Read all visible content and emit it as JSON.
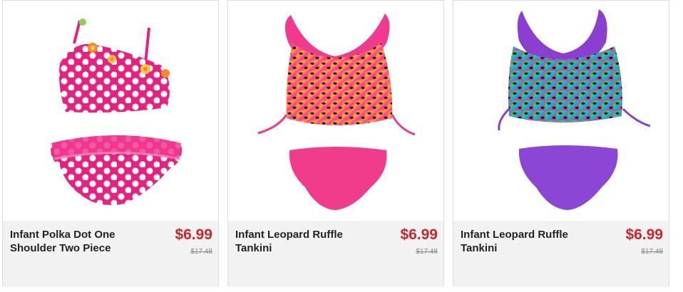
{
  "products": [
    {
      "title": "Infant Polka Dot One Shoulder Two Piece",
      "price": "$6.99",
      "original_price": "$17.48",
      "image_icon": "pink-polka-dot-bikini-image"
    },
    {
      "title": "Infant Leopard Ruffle Tankini",
      "price": "$6.99",
      "original_price": "$17.48",
      "image_icon": "pink-leopard-tankini-image"
    },
    {
      "title": "Infant Leopard Ruffle Tankini",
      "price": "$6.99",
      "original_price": "$17.48",
      "image_icon": "purple-leopard-tankini-image"
    }
  ],
  "colors": {
    "price": "#c8262b",
    "info_bg": "#f2f2f2",
    "card_border": "#dcdcdc"
  }
}
